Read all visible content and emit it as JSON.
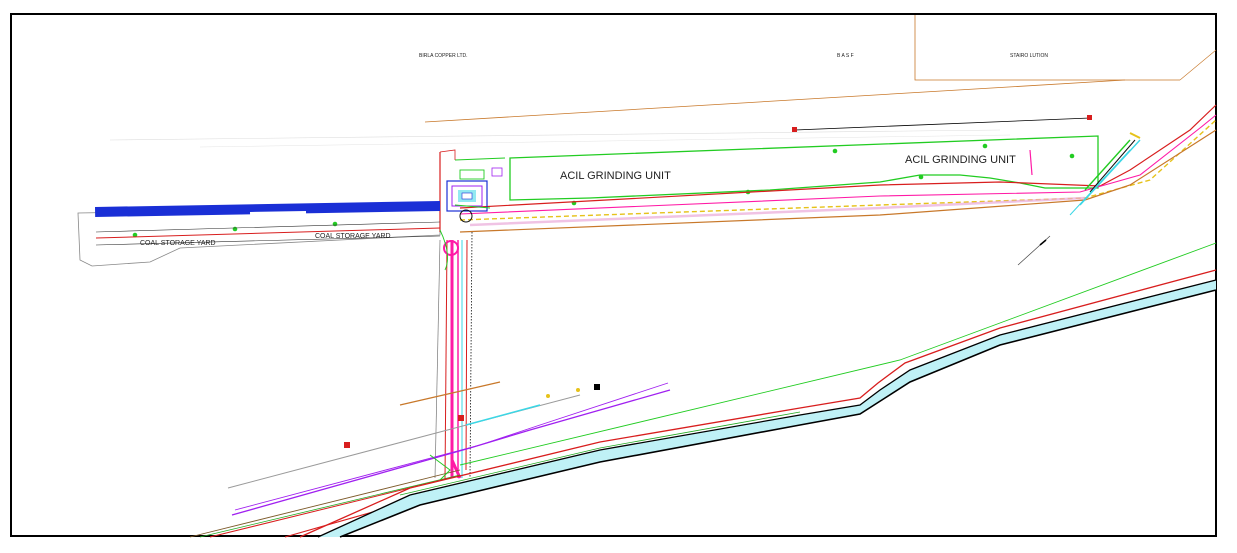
{
  "labels": {
    "birla_copper": "BIRLA COPPER LTD.",
    "basf": "B A S F",
    "stairo_lution": "STAIRO LUTION",
    "acil_grinding_unit_left": "ACIL GRINDING UNIT",
    "acil_grinding_unit_right": "ACIL GRINDING UNIT",
    "coal_storage_yard_left": "COAL STORAGE YARD",
    "coal_storage_yard_right": "COAL STORAGE YARD"
  },
  "colors": {
    "boundary_orange": "#c8782a",
    "green_outline": "#22cc22",
    "blue_conveyor": "#1a2fd6",
    "magenta": "#ff1aa6",
    "red": "#d81e1e",
    "cyan": "#3ad7e6",
    "purple": "#a020f0",
    "black": "#000000",
    "grey": "#9a9a9a",
    "yellow": "#e6c21a"
  }
}
